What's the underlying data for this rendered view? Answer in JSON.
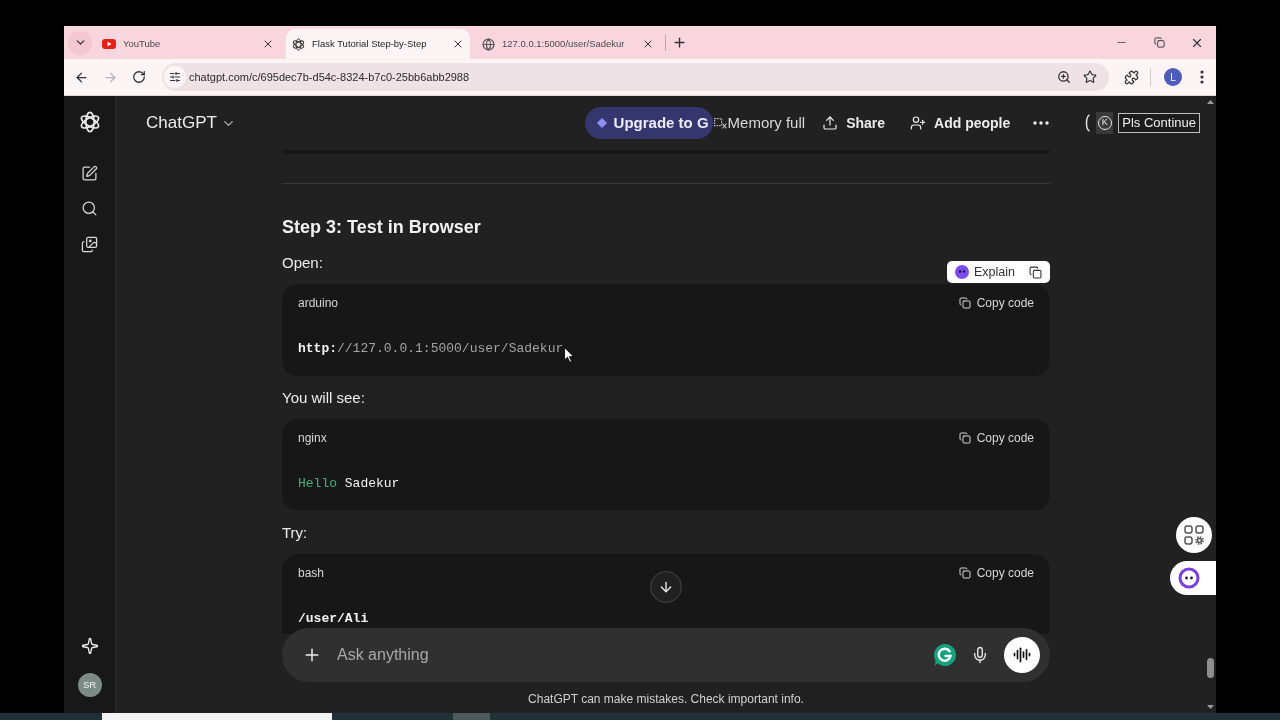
{
  "browser": {
    "tabs": [
      {
        "kind": "video",
        "title": "YouTube",
        "selected": false
      },
      {
        "kind": "chat",
        "title": "Flask Tutorial Step-by-Step",
        "selected": true
      },
      {
        "kind": "web",
        "title": "127.0.0.1:5000/user/Sadekur",
        "selected": false
      }
    ],
    "forward_disabled": true,
    "url": "chatgpt.com/c/695dec7b-d54c-8324-b7c0-25bb6abb2988",
    "profile_initial": "L"
  },
  "sidebar": {
    "avatar_initials": "SR"
  },
  "header": {
    "title": "ChatGPT",
    "upgrade_button": "Upgrade to G",
    "memory_status": "Memory full",
    "share_button": "Share",
    "add_people_button": "Add people",
    "account_initial": "K",
    "continue_button": "Pls Continue"
  },
  "message": {
    "heading": "Step 3: Test in Browser",
    "blocks": [
      {
        "kind": "paragraph",
        "text": "Open:"
      },
      {
        "kind": "code",
        "language": "arduino",
        "copy_label": "Copy code",
        "explain_button": "Explain",
        "tokens": [
          {
            "kind": "keyword",
            "text": "http:"
          },
          {
            "kind": "comment",
            "text": "//127.0.0.1:5000/user/Sadekur"
          }
        ]
      },
      {
        "kind": "paragraph",
        "text": "You will see:"
      },
      {
        "kind": "code",
        "language": "nginx",
        "copy_label": "Copy code",
        "tokens": [
          {
            "kind": "string",
            "text": "Hello"
          },
          {
            "kind": "plain",
            "text": " Sadekur"
          }
        ]
      },
      {
        "kind": "paragraph",
        "text": "Try:"
      },
      {
        "kind": "code",
        "language": "bash",
        "copy_label": "Copy code",
        "tokens": [
          {
            "kind": "keyword",
            "text": "/user/Ali"
          }
        ]
      }
    ]
  },
  "composer": {
    "placeholder": "Ask anything"
  },
  "disclaimer": "ChatGPT can make mistakes. Check important info."
}
